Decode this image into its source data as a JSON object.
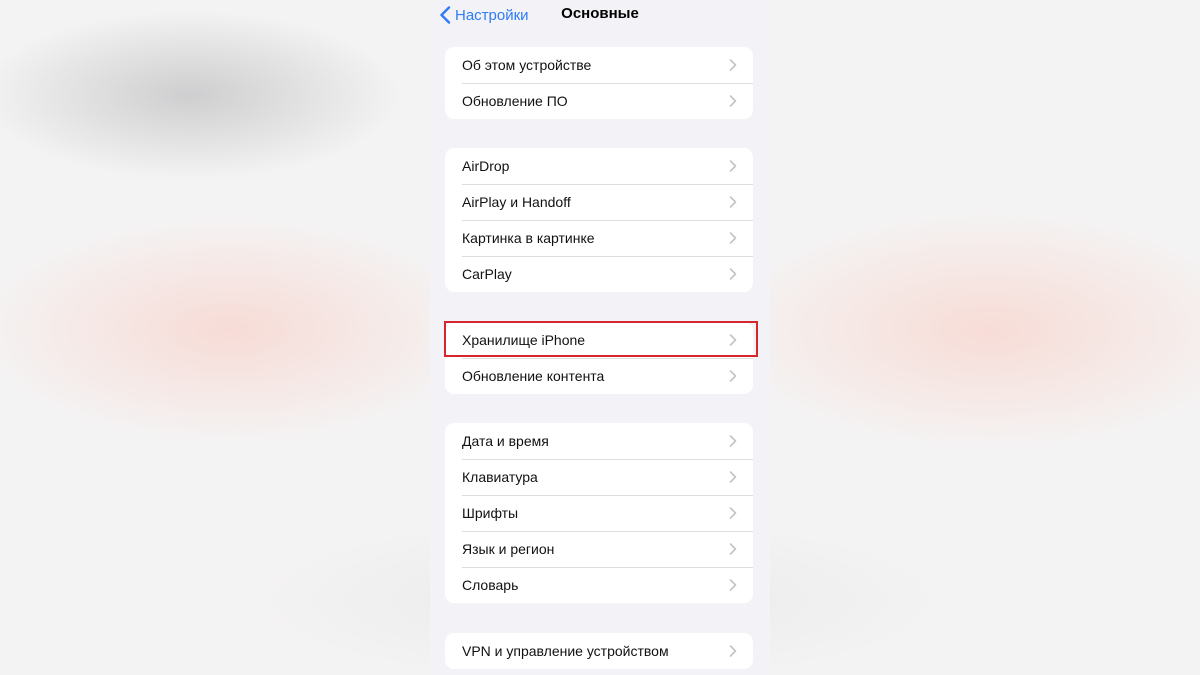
{
  "nav": {
    "back_label": "Настройки",
    "title": "Основные"
  },
  "groups": [
    {
      "items": [
        {
          "label": "Об этом устройстве"
        },
        {
          "label": "Обновление ПО"
        }
      ]
    },
    {
      "items": [
        {
          "label": "AirDrop"
        },
        {
          "label": "AirPlay и Handoff"
        },
        {
          "label": "Картинка в картинке"
        },
        {
          "label": "CarPlay"
        }
      ]
    },
    {
      "items": [
        {
          "label": "Хранилище iPhone"
        },
        {
          "label": "Обновление контента"
        }
      ]
    },
    {
      "items": [
        {
          "label": "Дата и время"
        },
        {
          "label": "Клавиатура"
        },
        {
          "label": "Шрифты"
        },
        {
          "label": "Язык и регион"
        },
        {
          "label": "Словарь"
        }
      ]
    },
    {
      "items": [
        {
          "label": "VPN и управление устройством"
        }
      ]
    }
  ],
  "colors": {
    "accent": "#2f7cf6",
    "highlight": "#d7252d",
    "background": "#f2f2f7",
    "separator": "#dcdce1",
    "chevron": "#c4c4c7"
  },
  "icons": {
    "back": "chevron-left-icon",
    "disclosure": "chevron-right-icon"
  },
  "annotation": {
    "highlighted_item": "Хранилище iPhone"
  }
}
